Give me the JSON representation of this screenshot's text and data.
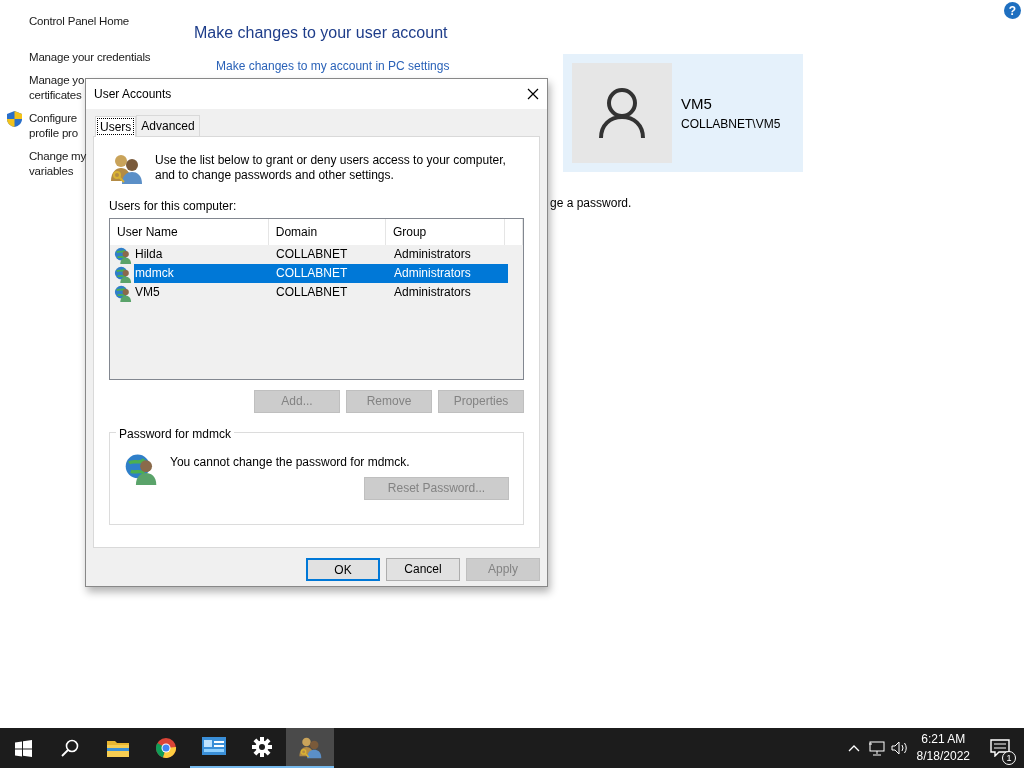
{
  "sidebar": {
    "items": [
      {
        "kind": "link",
        "lines": [
          "Control Panel Home"
        ]
      },
      {
        "kind": "link",
        "lines": [
          "Manage your credentials"
        ]
      },
      {
        "kind": "link",
        "lines": [
          "Manage yo",
          "certificates"
        ]
      },
      {
        "kind": "shield",
        "lines": [
          "Configure",
          "profile pro"
        ]
      },
      {
        "kind": "link",
        "lines": [
          "Change my",
          "variables"
        ]
      }
    ]
  },
  "main": {
    "heading": "Make changes to your user account",
    "link": "Make changes to my account in PC settings",
    "account": {
      "name": "VM5",
      "detail": "COLLABNET\\VM5"
    },
    "partial_text": "ge a password.",
    "help": "?"
  },
  "dialog": {
    "title": "User Accounts",
    "tabs": [
      {
        "label": "Users",
        "selected": true
      },
      {
        "label": "Advanced",
        "selected": false
      }
    ],
    "intro": "Use the list below to grant or deny users access to your computer, and to change passwords and other settings.",
    "list_label": "Users for this computer:",
    "columns": [
      "User Name",
      "Domain",
      "Group"
    ],
    "rows": [
      {
        "cells": [
          "Hilda",
          "COLLABNET",
          "Administrators"
        ],
        "selected": false
      },
      {
        "cells": [
          "mdmck",
          "COLLABNET",
          "Administrators"
        ],
        "selected": true
      },
      {
        "cells": [
          "VM5",
          "COLLABNET",
          "Administrators"
        ],
        "selected": false
      }
    ],
    "list_buttons": [
      {
        "label": "Add...",
        "disabled": true
      },
      {
        "label": "Remove",
        "disabled": true
      },
      {
        "label": "Properties",
        "disabled": true
      }
    ],
    "password": {
      "legend": "Password for mdmck",
      "message": "You cannot change the password for mdmck.",
      "button": {
        "label": "Reset Password...",
        "disabled": true
      }
    },
    "footer_buttons": [
      {
        "label": "OK",
        "disabled": false,
        "default": true
      },
      {
        "label": "Cancel",
        "disabled": false,
        "default": false
      },
      {
        "label": "Apply",
        "disabled": true,
        "default": false
      }
    ]
  },
  "taskbar": {
    "items": [
      {
        "kind": "start",
        "running": false,
        "selected": false
      },
      {
        "kind": "search",
        "running": false,
        "selected": false
      },
      {
        "kind": "folder",
        "running": false,
        "selected": false
      },
      {
        "kind": "browser",
        "running": false,
        "selected": false
      },
      {
        "kind": "control-panel",
        "running": true,
        "selected": false
      },
      {
        "kind": "settings",
        "running": true,
        "selected": false
      },
      {
        "kind": "users",
        "running": true,
        "selected": true
      }
    ],
    "time": "6:21 AM",
    "date": "8/18/2022",
    "notifications": "1"
  }
}
